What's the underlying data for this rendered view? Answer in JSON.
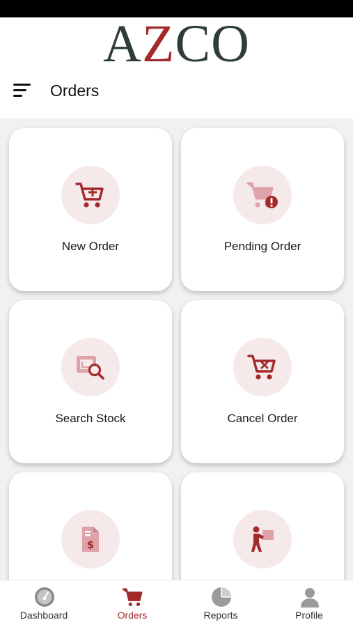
{
  "app": {
    "logo_text_a": "A",
    "logo_text_z": "Z",
    "logo_text_co": "CO",
    "brand_colors": {
      "primary": "#a32a2a",
      "dark": "#2f3d38",
      "tint": "#f6e9ea"
    }
  },
  "header": {
    "menu_icon": "menu-icon",
    "title": "Orders"
  },
  "cards": [
    {
      "label": "New Order",
      "icon": "cart-plus-icon"
    },
    {
      "label": "Pending Order",
      "icon": "cart-pending-icon"
    },
    {
      "label": "Search Stock",
      "icon": "search-stock-icon"
    },
    {
      "label": "Cancel Order",
      "icon": "cart-cancel-icon"
    },
    {
      "label": "",
      "icon": "invoice-dollar-icon"
    },
    {
      "label": "",
      "icon": "delivery-person-icon"
    }
  ],
  "bottom_nav": {
    "active": "Orders",
    "items": [
      {
        "label": "Dashboard",
        "icon": "gauge-icon"
      },
      {
        "label": "Orders",
        "icon": "cart-icon"
      },
      {
        "label": "Reports",
        "icon": "pie-chart-icon"
      },
      {
        "label": "Profile",
        "icon": "person-icon"
      }
    ]
  }
}
